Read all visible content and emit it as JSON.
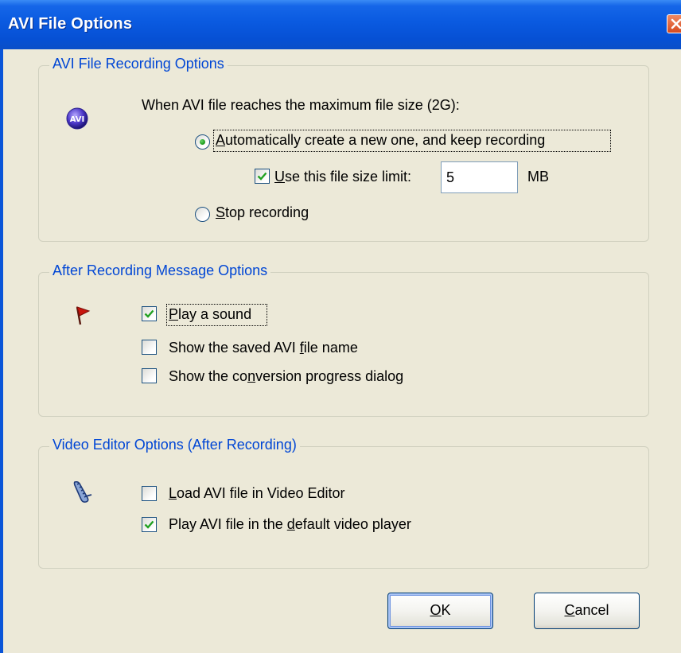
{
  "window": {
    "title": "AVI File Options"
  },
  "groups": {
    "recording": {
      "legend": "AVI File Recording Options",
      "prompt": "When AVI file reaches the maximum file size (2G):",
      "auto_create": {
        "label_pre": "",
        "mnemonic": "A",
        "label_post": "utomatically create a new one, and keep recording",
        "selected": true
      },
      "use_limit": {
        "mnemonic": "U",
        "label_post": "se this file size limit:",
        "checked": true
      },
      "size_value": "5",
      "size_unit": "MB",
      "stop": {
        "mnemonic": "S",
        "label_post": "top recording",
        "selected": false
      }
    },
    "message": {
      "legend": "After Recording Message Options",
      "play_sound": {
        "mnemonic": "P",
        "label_post": "lay a sound",
        "checked": true
      },
      "show_name": {
        "label_pre": "Show the saved AVI ",
        "mnemonic": "f",
        "label_post": "ile name",
        "checked": false
      },
      "show_progress": {
        "label_pre": "Show the co",
        "mnemonic": "n",
        "label_post": "version progress dialog",
        "checked": false
      }
    },
    "editor": {
      "legend": "Video Editor Options (After Recording)",
      "load_editor": {
        "mnemonic": "L",
        "label_post": "oad AVI file in Video Editor",
        "checked": false
      },
      "play_default": {
        "label_pre": "Play AVI file in the ",
        "mnemonic": "d",
        "label_post": "efault video player",
        "checked": true
      }
    }
  },
  "buttons": {
    "ok": {
      "mnemonic": "O",
      "label_post": "K"
    },
    "cancel": {
      "mnemonic": "C",
      "label_post": "ancel"
    }
  },
  "icons": {
    "avi": "avi-logo-icon",
    "flag": "red-flag-icon",
    "editor": "film-strip-icon",
    "close": "close-icon"
  },
  "colors": {
    "title_bar": "#0a5ae0",
    "dialog_bg": "#ece9d8",
    "legend_text": "#0046d5",
    "radio_dot": "#21a121",
    "check_mark": "#21a121"
  }
}
